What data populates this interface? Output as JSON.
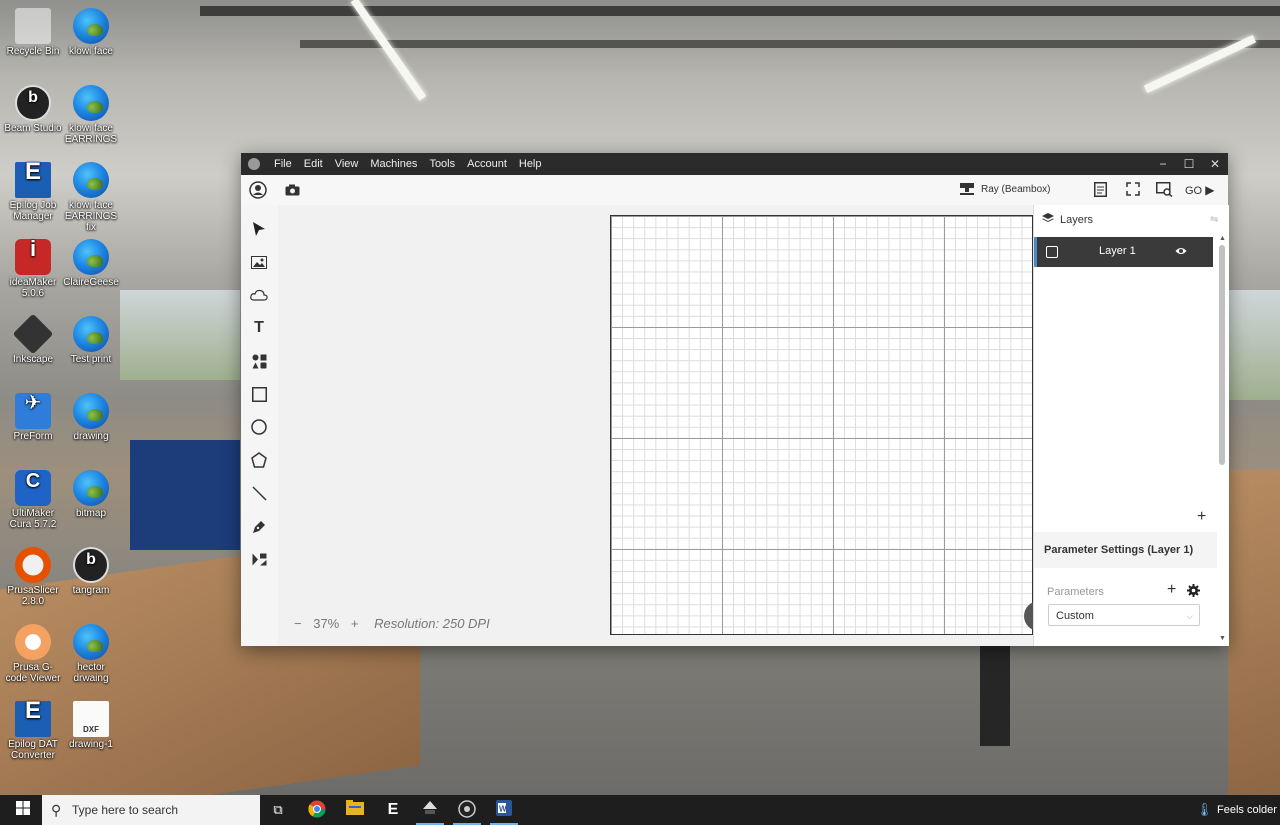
{
  "desktop": {
    "icons": [
      {
        "label": "Recycle Bin",
        "icon": "recycle-bin-icon"
      },
      {
        "label": "klowi face",
        "icon": "edge-icon"
      },
      {
        "label": "Beam Studio",
        "icon": "beam-studio-icon"
      },
      {
        "label": "klowi face EARRINGS",
        "icon": "edge-icon"
      },
      {
        "label": "Epilog Job Manager",
        "icon": "epilog-icon"
      },
      {
        "label": "klowi face EARRINGS fix",
        "icon": "edge-icon"
      },
      {
        "label": "ideaMaker 5.0.6",
        "icon": "ideamaker-icon"
      },
      {
        "label": "ClaireGeese",
        "icon": "edge-icon"
      },
      {
        "label": "Inkscape",
        "icon": "inkscape-icon"
      },
      {
        "label": "Test print",
        "icon": "edge-icon"
      },
      {
        "label": "PreForm",
        "icon": "preform-icon"
      },
      {
        "label": "drawing",
        "icon": "edge-icon"
      },
      {
        "label": "UltiMaker Cura 5.7.2",
        "icon": "cura-icon"
      },
      {
        "label": "bitmap",
        "icon": "edge-icon"
      },
      {
        "label": "PrusaSlicer 2.8.0",
        "icon": "prusaslicer-icon"
      },
      {
        "label": "tangram",
        "icon": "beam-studio-icon"
      },
      {
        "label": "Prusa G-code Viewer",
        "icon": "gcode-viewer-icon"
      },
      {
        "label": "hector drwaing",
        "icon": "edge-icon"
      },
      {
        "label": "Epilog DAT Converter",
        "icon": "epilog-icon"
      },
      {
        "label": "drawing-1",
        "icon": "dxf-file-icon"
      }
    ]
  },
  "app": {
    "menu": [
      "File",
      "Edit",
      "View",
      "Machines",
      "Tools",
      "Account",
      "Help"
    ],
    "toolbar": {
      "machine": "Ray (Beambox)",
      "go_label": "GO"
    },
    "tools": [
      "select",
      "image",
      "cloud",
      "text",
      "elements",
      "rectangle",
      "ellipse",
      "polygon",
      "line",
      "pen",
      "dmkt"
    ],
    "zoom": {
      "minus": "−",
      "value": "37%",
      "plus": "+",
      "resolution": "Resolution: 250 DPI"
    },
    "layers_panel": {
      "title": "Layers",
      "layers": [
        {
          "name": "Layer 1",
          "visible": true
        }
      ],
      "add_symbol": "+"
    },
    "parameters": {
      "header": "Parameter Settings (Layer 1)",
      "label": "Parameters",
      "selected": "Custom"
    }
  },
  "taskbar": {
    "search_placeholder": "Type here to search",
    "weather": "Feels colder"
  },
  "colors": {
    "titlebar": "#2b2b2b",
    "layer_selected": "#3a3a3a",
    "accent": "#4a8ac9"
  }
}
